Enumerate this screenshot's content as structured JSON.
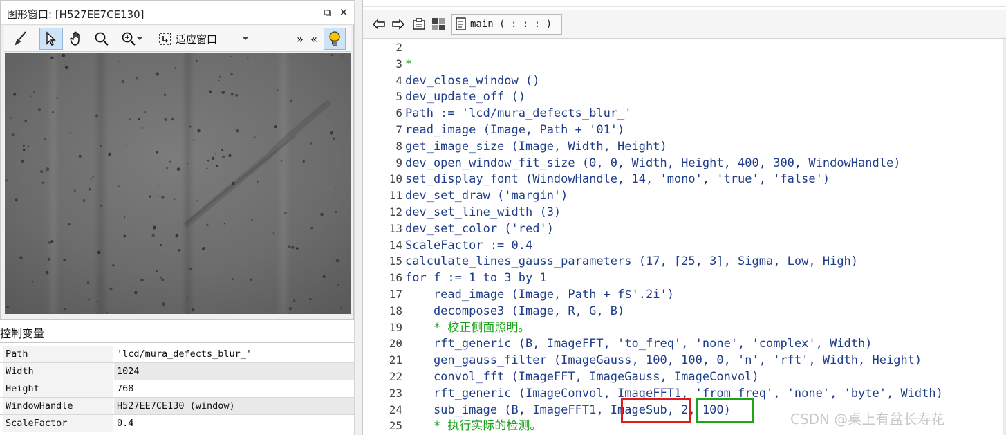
{
  "graphics_window": {
    "title": "图形窗口: [H527EE7CE130]",
    "restore_glyph": "⧉",
    "close_glyph": "✕",
    "toolbar": {
      "fit_label": "适应窗口",
      "expand_glyph": "»",
      "collapse_glyph": "«"
    }
  },
  "control_variables": {
    "title": "控制变量",
    "rows": [
      {
        "name": "Path",
        "value": "'lcd/mura_defects_blur_'"
      },
      {
        "name": "Width",
        "value": "1024"
      },
      {
        "name": "Height",
        "value": "768"
      },
      {
        "name": "WindowHandle",
        "value": "H527EE7CE130 (window)"
      },
      {
        "name": "ScaleFactor",
        "value": "0.4"
      }
    ]
  },
  "editor": {
    "procedure": "main ( : : : )",
    "lines": [
      {
        "n": "2",
        "text": ""
      },
      {
        "n": "3",
        "text": "*",
        "comment": true
      },
      {
        "n": "4",
        "text": "dev_close_window ()"
      },
      {
        "n": "5",
        "text": "dev_update_off ()"
      },
      {
        "n": "6",
        "text": "Path := 'lcd/mura_defects_blur_'"
      },
      {
        "n": "7",
        "text": "read_image (Image, Path + '01')"
      },
      {
        "n": "8",
        "text": "get_image_size (Image, Width, Height)"
      },
      {
        "n": "9",
        "text": "dev_open_window_fit_size (0, 0, Width, Height, 400, 300, WindowHandle)"
      },
      {
        "n": "10",
        "text": "set_display_font (WindowHandle, 14, 'mono', 'true', 'false')"
      },
      {
        "n": "11",
        "text": "dev_set_draw ('margin')"
      },
      {
        "n": "12",
        "text": "dev_set_line_width (3)"
      },
      {
        "n": "13",
        "text": "dev_set_color ('red')"
      },
      {
        "n": "14",
        "text": "ScaleFactor := 0.4"
      },
      {
        "n": "15",
        "text": "calculate_lines_gauss_parameters (17, [25, 3], Sigma, Low, High)"
      },
      {
        "n": "16",
        "text": "for f := 1 to 3 by 1"
      },
      {
        "n": "17",
        "text": "    read_image (Image, Path + f$'.2i')"
      },
      {
        "n": "18",
        "text": "    decompose3 (Image, R, G, B)"
      },
      {
        "n": "19",
        "text": "    * 校正侧面照明。",
        "comment": true
      },
      {
        "n": "20",
        "text": "    rft_generic (B, ImageFFT, 'to_freq', 'none', 'complex', Width)"
      },
      {
        "n": "21",
        "text": "    gen_gauss_filter (ImageGauss, 100, 100, 0, 'n', 'rft', Width, Height)"
      },
      {
        "n": "22",
        "text": "    convol_fft (ImageFFT, ImageGauss, ImageConvol)"
      },
      {
        "n": "23",
        "text": "    rft_generic (ImageConvol, ImageFFT1, 'from_freq', 'none', 'byte', Width)"
      },
      {
        "n": "24",
        "text": "    sub_image (B, ImageFFT1, ImageSub, 2, 100)"
      },
      {
        "n": "25",
        "text": "    * 执行实际的检测。",
        "comment": true
      }
    ]
  },
  "watermark": "CSDN @桌上有盆长寿花",
  "colors": {
    "code_text": "#1f3d8a",
    "comment": "#19a319",
    "highlight_red": "#e11b1b",
    "highlight_green": "#1ca61c"
  }
}
